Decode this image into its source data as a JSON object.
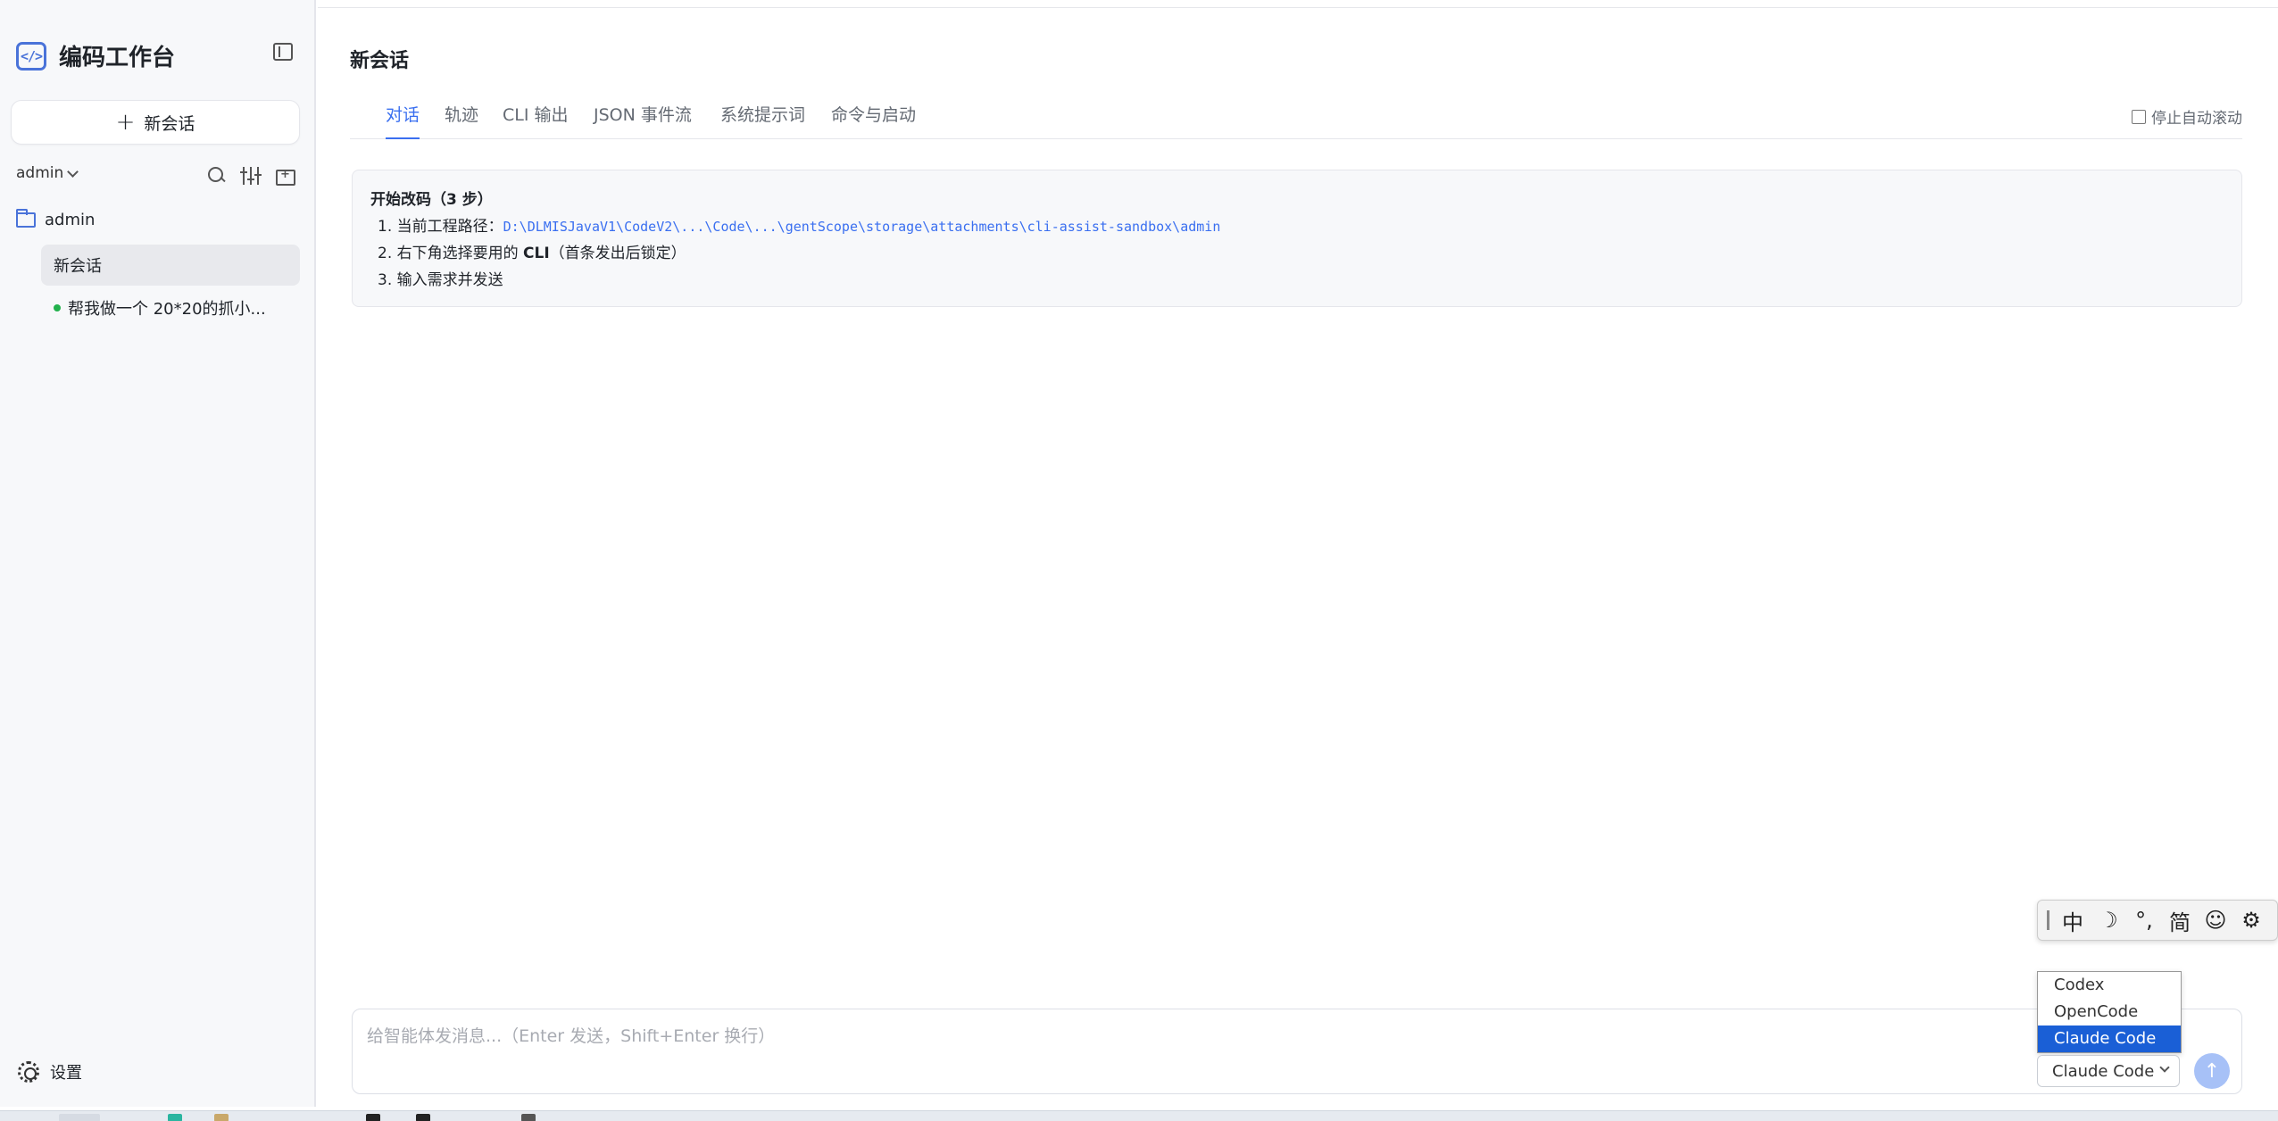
{
  "sidebar": {
    "brand_title": "编码工作台",
    "brand_logo_glyph": "</>",
    "new_session_label": "新会话",
    "user_label": "admin",
    "folder_label": "admin",
    "sessions": [
      {
        "label": "新会话",
        "active": true
      },
      {
        "label": "帮我做一个 20*20的抓小...",
        "active": false,
        "status": "running"
      }
    ],
    "settings_label": "设置"
  },
  "main": {
    "page_title": "新会话",
    "tabs": [
      {
        "label": "对话",
        "active": true
      },
      {
        "label": "轨迹",
        "active": false
      },
      {
        "label": "CLI 输出",
        "active": false
      },
      {
        "label": "JSON 事件流",
        "active": false
      },
      {
        "label": "系统提示词",
        "active": false
      },
      {
        "label": "命令与启动",
        "active": false
      }
    ],
    "autoscroll_label": "停止自动滚动",
    "autoscroll_checked": false,
    "guide": {
      "title": "开始改码（3 步）",
      "step1_prefix": "1. 当前工程路径：",
      "step1_path": "D:\\DLMISJavaV1\\CodeV2\\...\\Code\\...\\gentScope\\storage\\attachments\\cli-assist-sandbox\\admin",
      "step2_prefix": "2. 右下角选择要用的 ",
      "step2_strong": "CLI",
      "step2_suffix": "（首条发出后锁定）",
      "step3": "3. 输入需求并发送"
    }
  },
  "composer": {
    "placeholder": "给智能体发消息...（Enter 发送，Shift+Enter 换行）",
    "value": "",
    "cli_selected": "Claude Code",
    "cli_options": [
      "Codex",
      "OpenCode",
      "Claude Code"
    ],
    "send_glyph": "↑"
  },
  "ime": {
    "items": [
      "中",
      "☽",
      "°,",
      "简",
      "☺",
      "⚙"
    ]
  },
  "colors": {
    "accent": "#3a6ff0",
    "status_running": "#22b14c",
    "dropdown_selected": "#1a5fd6"
  }
}
